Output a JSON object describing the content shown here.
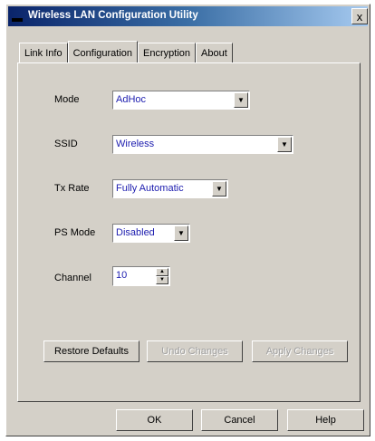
{
  "window": {
    "title": "Wireless LAN Configuration Utility",
    "close_glyph": "x"
  },
  "tabs": [
    "Link Info",
    "Configuration",
    "Encryption",
    "About"
  ],
  "active_tab": "Configuration",
  "form": {
    "mode": {
      "label": "Mode",
      "value": "AdHoc"
    },
    "ssid": {
      "label": "SSID",
      "value": "Wireless"
    },
    "tx_rate": {
      "label": "Tx Rate",
      "value": "Fully Automatic"
    },
    "ps_mode": {
      "label": "PS Mode",
      "value": "Disabled"
    },
    "channel": {
      "label": "Channel",
      "value": "10"
    }
  },
  "actions": {
    "restore_defaults": "Restore Defaults",
    "undo_changes": "Undo Changes",
    "apply_changes": "Apply Changes"
  },
  "dialog_buttons": {
    "ok": "OK",
    "cancel": "Cancel",
    "help": "Help"
  },
  "icons": {
    "dropdown": "triangle-down-icon",
    "spin_up": "triangle-up-icon",
    "spin_down": "triangle-down-icon"
  }
}
